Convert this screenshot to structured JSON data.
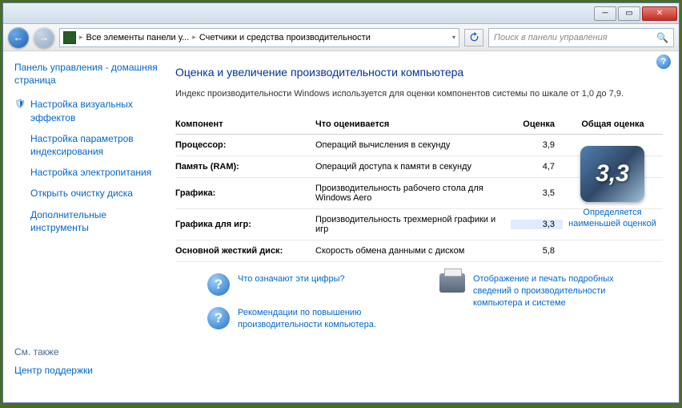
{
  "breadcrumb": {
    "seg1": "Все элементы панели у...",
    "seg2": "Счетчики и средства производительности"
  },
  "search": {
    "placeholder": "Поиск в панели управления"
  },
  "sidebar": {
    "home": "Панель управления - домашняя страница",
    "links": [
      "Настройка визуальных эффектов",
      "Настройка параметров индексирования",
      "Настройка электропитания",
      "Открыть очистку диска",
      "Дополнительные инструменты"
    ],
    "also_label": "См. также",
    "also_link": "Центр поддержки"
  },
  "main": {
    "heading": "Оценка и увеличение производительности компьютера",
    "description": "Индекс производительности Windows используется для оценки компонентов системы по шкале от 1,0 до 7,9.",
    "headers": {
      "component": "Компонент",
      "whatrated": "Что оценивается",
      "subscore": "Оценка",
      "basescore": "Общая оценка"
    },
    "rows": [
      {
        "name": "Процессор:",
        "desc": "Операций вычисления в секунду",
        "score": "3,9"
      },
      {
        "name": "Память (RAM):",
        "desc": "Операций доступа к памяти в секунду",
        "score": "4,7"
      },
      {
        "name": "Графика:",
        "desc": "Производительность рабочего стола для Windows Aero",
        "score": "3,5"
      },
      {
        "name": "Графика для игр:",
        "desc": "Производительность трехмерной графики и игр",
        "score": "3,3"
      },
      {
        "name": "Основной жесткий диск:",
        "desc": "Скорость обмена данными с диском",
        "score": "5,8"
      }
    ],
    "base_score": "3,3",
    "base_label": "Определяется наименьшей оценкой",
    "bottom": {
      "q1": "Что означают эти цифры?",
      "q2": "Рекомендации по повышению производительности компьютера.",
      "print": "Отображение и печать подробных сведений о производительности компьютера и системе"
    }
  }
}
